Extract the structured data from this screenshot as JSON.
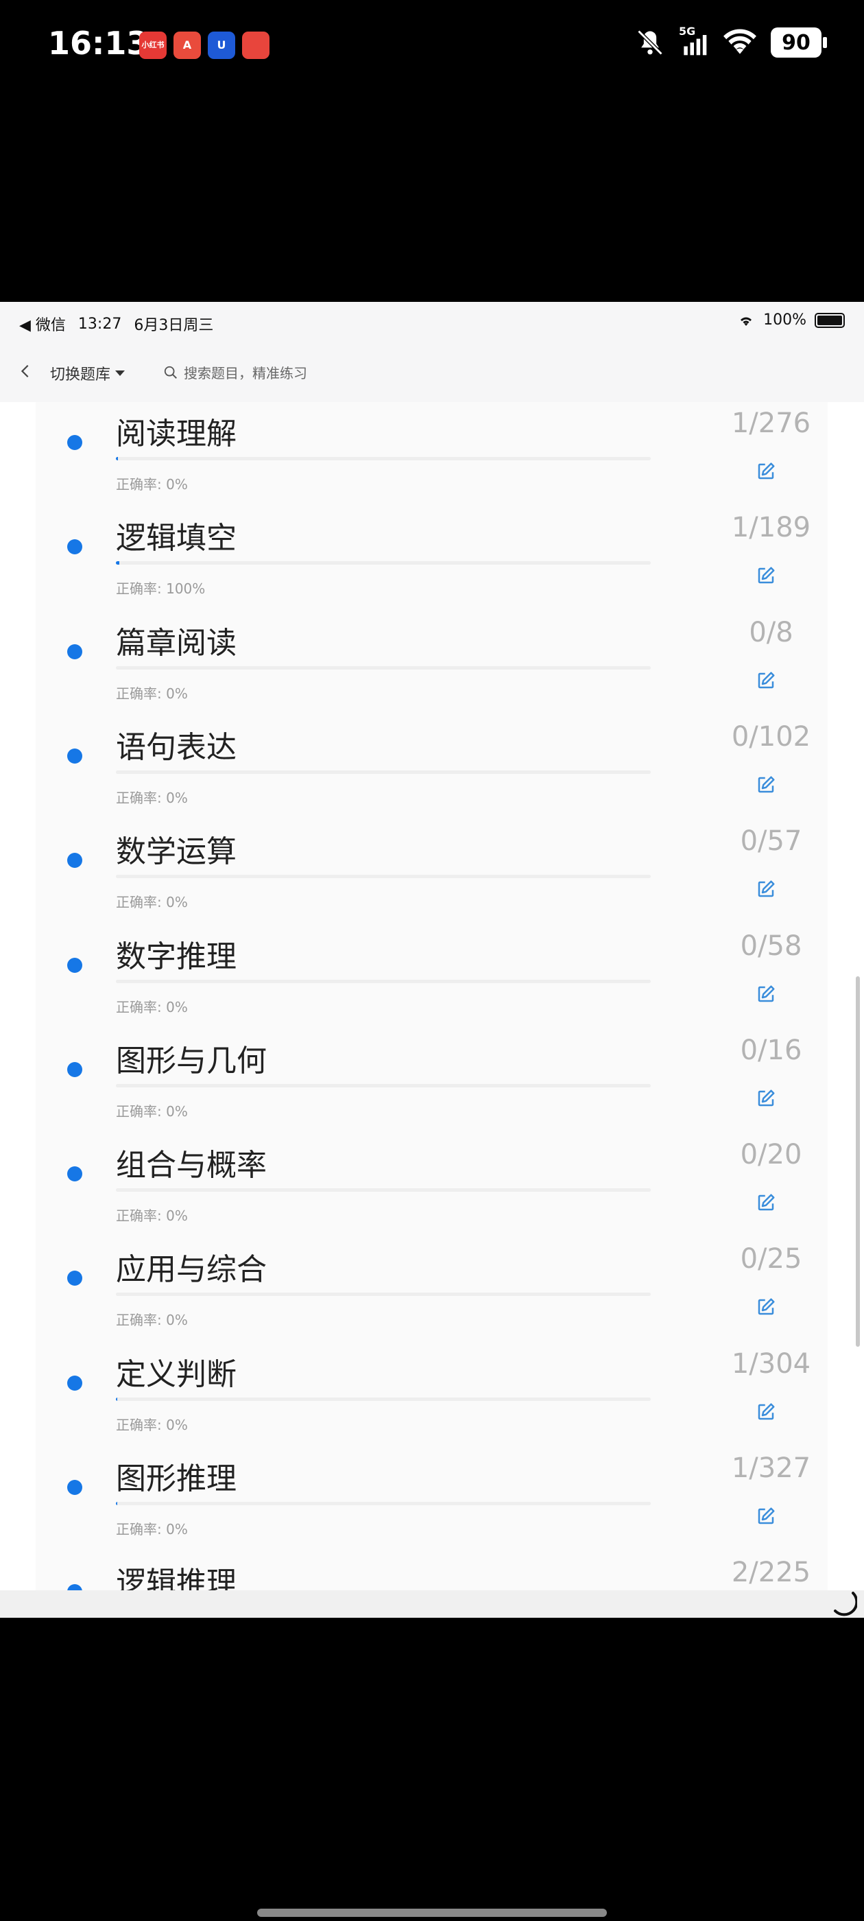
{
  "phone_status": {
    "time": "16:13",
    "apps": [
      {
        "name": "xiaohongshu",
        "label": "小红书"
      },
      {
        "name": "app-a",
        "label": "A"
      },
      {
        "name": "app-u",
        "label": "U"
      },
      {
        "name": "app-pattern",
        "label": ""
      }
    ],
    "network": "5G",
    "battery": "90"
  },
  "inner_status": {
    "back_app": "◀ 微信",
    "time": "13:27",
    "date": "6月3日周三",
    "battery": "100%"
  },
  "nav": {
    "switch_label": "切换题库",
    "search_placeholder": "搜索题目，精准练习"
  },
  "rate_prefix": "正确率: ",
  "items": [
    {
      "title": "阅读理解",
      "count": "1/276",
      "rate": "0%",
      "progress": 0.004
    },
    {
      "title": "逻辑填空",
      "count": "1/189",
      "rate": "100%",
      "progress": 0.006
    },
    {
      "title": "篇章阅读",
      "count": "0/8",
      "rate": "0%",
      "progress": 0
    },
    {
      "title": "语句表达",
      "count": "0/102",
      "rate": "0%",
      "progress": 0
    },
    {
      "title": "数学运算",
      "count": "0/57",
      "rate": "0%",
      "progress": 0
    },
    {
      "title": "数字推理",
      "count": "0/58",
      "rate": "0%",
      "progress": 0
    },
    {
      "title": "图形与几何",
      "count": "0/16",
      "rate": "0%",
      "progress": 0
    },
    {
      "title": "组合与概率",
      "count": "0/20",
      "rate": "0%",
      "progress": 0
    },
    {
      "title": "应用与综合",
      "count": "0/25",
      "rate": "0%",
      "progress": 0
    },
    {
      "title": "定义判断",
      "count": "1/304",
      "rate": "0%",
      "progress": 0.003
    },
    {
      "title": "图形推理",
      "count": "1/327",
      "rate": "0%",
      "progress": 0.003
    },
    {
      "title": "逻辑推理",
      "count": "2/225",
      "rate": "",
      "progress": 0.009
    }
  ],
  "colors": {
    "accent": "#1677e6",
    "count_text": "#b3b3b3",
    "rate_text": "#9a9a9a"
  }
}
